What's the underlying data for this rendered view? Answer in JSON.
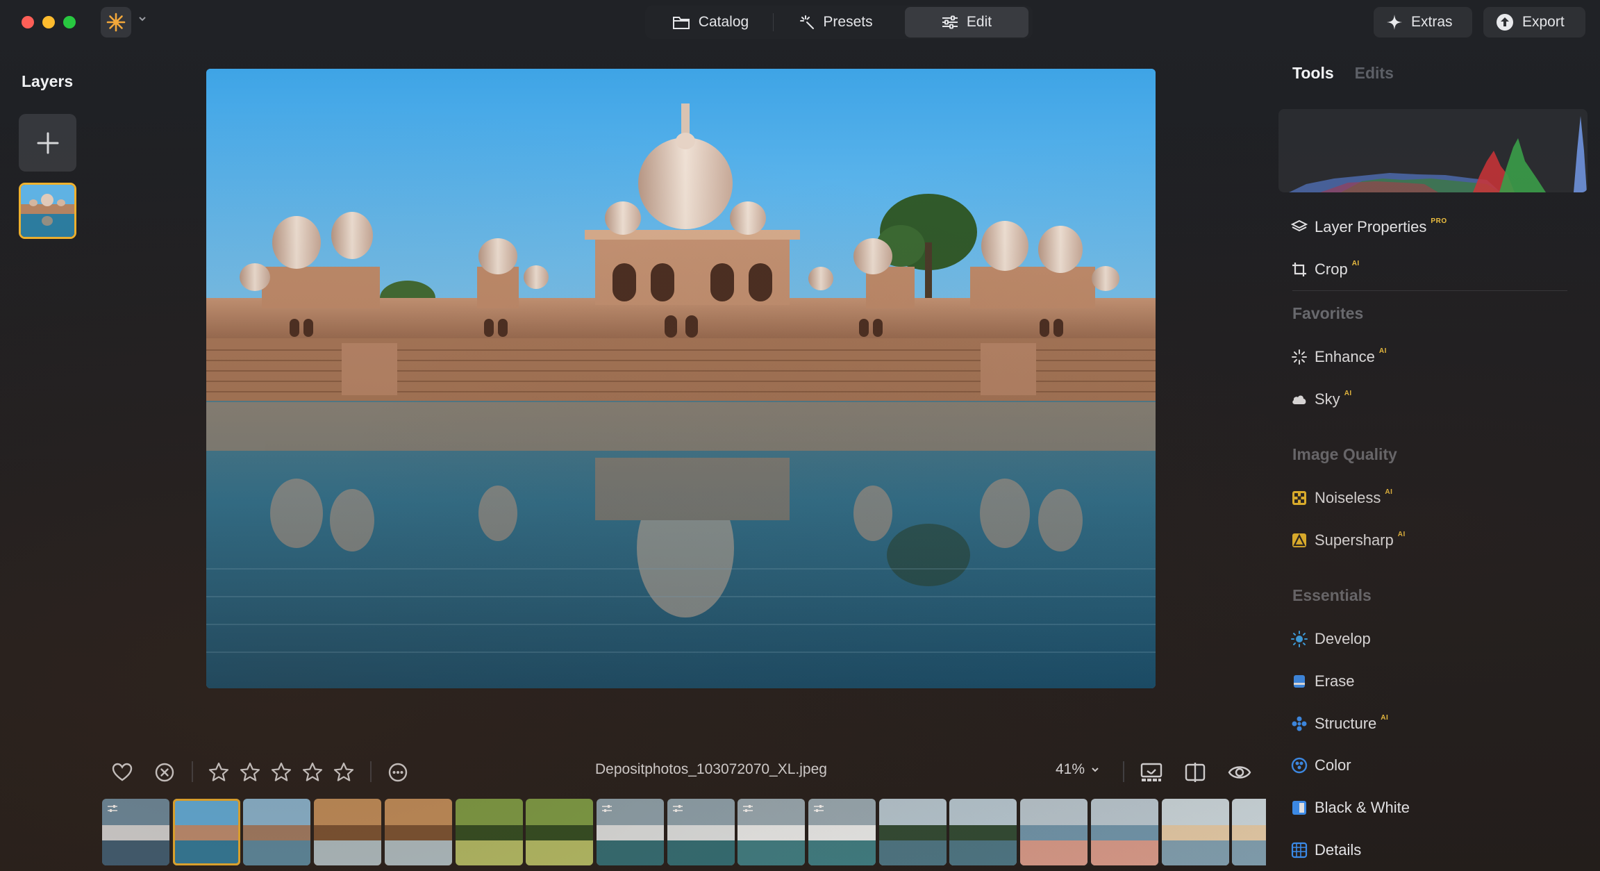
{
  "titlebar": {
    "tabs": [
      {
        "label": "Catalog",
        "icon": "folder-icon"
      },
      {
        "label": "Presets",
        "icon": "sparkles-icon"
      },
      {
        "label": "Edit",
        "icon": "sliders-icon",
        "active": true
      }
    ],
    "extras_label": "Extras",
    "export_label": "Export"
  },
  "layers": {
    "title": "Layers",
    "add_icon": "plus-icon",
    "items": [
      {
        "name": "temple-reflection-layer",
        "selected": true
      }
    ]
  },
  "photo": {
    "subject": "temple-reflection",
    "colors": {
      "sky": "#5fb6ea",
      "stone": "#b98a6a",
      "water": "#1d6b8c"
    }
  },
  "bottom_bar": {
    "filename": "Depositphotos_103072070_XL.jpeg",
    "zoom": "41%",
    "rating": 0,
    "rating_max": 5,
    "icons": [
      "heart-icon",
      "reject-icon",
      "star-icon",
      "more-icon",
      "display-icon",
      "compare-icon",
      "eye-icon",
      "chevron-down-icon"
    ]
  },
  "filmstrip": [
    {
      "kind": "swan",
      "edited": true,
      "selected": false
    },
    {
      "kind": "temple",
      "edited": false,
      "selected": true
    },
    {
      "kind": "temple-far",
      "edited": false,
      "selected": false
    },
    {
      "kind": "arches",
      "edited": false,
      "selected": false
    },
    {
      "kind": "arches",
      "edited": false,
      "selected": false
    },
    {
      "kind": "foliage",
      "edited": false,
      "selected": false
    },
    {
      "kind": "foliage",
      "edited": false,
      "selected": false
    },
    {
      "kind": "surfer",
      "edited": true,
      "selected": false
    },
    {
      "kind": "surfer",
      "edited": true,
      "selected": false
    },
    {
      "kind": "surf-wave",
      "edited": true,
      "selected": false
    },
    {
      "kind": "surf-wave",
      "edited": true,
      "selected": false
    },
    {
      "kind": "lake-forest",
      "edited": false,
      "selected": false
    },
    {
      "kind": "lake-forest",
      "edited": false,
      "selected": false
    },
    {
      "kind": "flamingos",
      "edited": false,
      "selected": false
    },
    {
      "kind": "flamingos",
      "edited": false,
      "selected": false
    },
    {
      "kind": "beach",
      "edited": false,
      "selected": false
    },
    {
      "kind": "beach",
      "edited": false,
      "selected": false
    }
  ],
  "right_panel": {
    "tab_tools": "Tools",
    "tab_edits": "Edits",
    "histogram": {
      "colors": {
        "blue": "#5b7fc4",
        "green": "#3aa04a",
        "red": "#d0363a"
      }
    },
    "top_items": [
      {
        "label": "Layer Properties",
        "badge": "PRO",
        "icon": "layers-icon"
      },
      {
        "label": "Crop",
        "badge": "AI",
        "icon": "crop-icon"
      }
    ],
    "sections": [
      {
        "title": "Favorites",
        "items": [
          {
            "label": "Enhance",
            "badge": "AI",
            "icon": "enhance-icon",
            "color": "#ffffff"
          },
          {
            "label": "Sky",
            "badge": "AI",
            "icon": "cloud-icon",
            "color": "#ffffff"
          }
        ]
      },
      {
        "title": "Image Quality",
        "items": [
          {
            "label": "Noiseless",
            "badge": "AI",
            "icon": "noiseless-icon",
            "color": "#f3c22e"
          },
          {
            "label": "Supersharp",
            "badge": "AI",
            "icon": "supersharp-icon",
            "color": "#f3c22e"
          }
        ]
      },
      {
        "title": "Essentials",
        "items": [
          {
            "label": "Develop",
            "badge": "",
            "icon": "develop-icon",
            "color": "#3aa8f2"
          },
          {
            "label": "Erase",
            "badge": "",
            "icon": "erase-icon",
            "color": "#3a8ff2"
          },
          {
            "label": "Structure",
            "badge": "AI",
            "icon": "structure-icon",
            "color": "#3a8ff2"
          },
          {
            "label": "Color",
            "badge": "",
            "icon": "color-icon",
            "color": "#3a8ff2"
          },
          {
            "label": "Black & White",
            "badge": "",
            "icon": "bw-icon",
            "color": "#3a8ff2"
          },
          {
            "label": "Details",
            "badge": "",
            "icon": "details-icon",
            "color": "#3a8ff2"
          }
        ]
      }
    ]
  }
}
